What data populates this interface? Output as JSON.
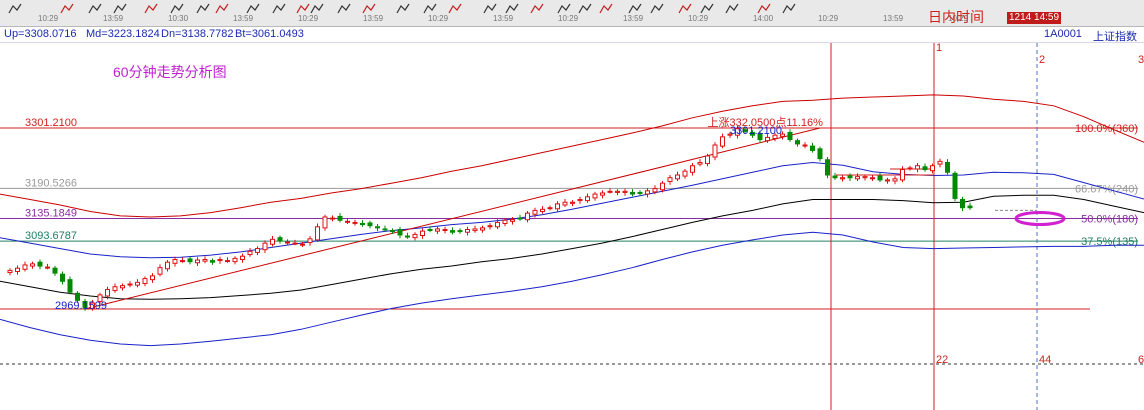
{
  "toolbar": {
    "times": [
      "10:29",
      "13:59",
      "10:30",
      "13:59",
      "10:29",
      "13:59",
      "10:29",
      "13:59",
      "10:29",
      "13:59",
      "10:29",
      "14:00",
      "10:29",
      "13:59",
      "10:29"
    ],
    "right_label": "日内时间",
    "badge": "1214 14:59"
  },
  "status": {
    "up": "Up=3308.0716",
    "md": "Md=3223.1824",
    "dn": "Dn=3138.7782",
    "bt": "Bt=3061.0493",
    "code": "1A0001",
    "name": "上证指数"
  },
  "colors": {
    "candle_up": "#e01010",
    "candle_down": "#008a00",
    "band_outer": "#cc0000",
    "band_inner": "#1822c8",
    "band_mid": "#000000",
    "level_red": "#d02020",
    "level_gray": "#999999",
    "level_purple": "#8a2aa0",
    "level_teal": "#208060",
    "caption": "#c020d0",
    "marker": "#d020d0"
  },
  "chart_data": {
    "type": "candlestick",
    "title": "60分钟走势分析图",
    "ylim": [
      2900,
      3400
    ],
    "levels": [
      {
        "value": 3301.21,
        "label": "3301.2100",
        "right": "100.0%(360)"
      },
      {
        "value": 3190.5266,
        "label": "3190.5266",
        "right": "66.67%(240)"
      },
      {
        "value": 3135.1849,
        "label": "3135.1849",
        "right": "50.0%(180)"
      },
      {
        "value": 3093.6787,
        "label": "3093.6787",
        "right": "37.5%(135)"
      },
      {
        "value": 2969.1599,
        "label": "",
        "right": ""
      }
    ],
    "annotations": [
      {
        "text": "上涨332.0500点11.16%",
        "bar": 97,
        "value": 3305
      },
      {
        "text": "3301.2100",
        "bar": 100,
        "value": 3290
      },
      {
        "text": "2969.1599",
        "bar": 10,
        "value": 2969.16
      }
    ],
    "time_markers": [
      "1",
      "2",
      "22",
      "44",
      "6",
      "3"
    ],
    "closes": [
      3040,
      3044,
      3050,
      3052,
      3048,
      3046,
      3035,
      3020,
      3000,
      2985,
      2972,
      2980,
      2995,
      3005,
      3010,
      3012,
      3015,
      3018,
      3025,
      3030,
      3045,
      3055,
      3060,
      3058,
      3056,
      3059,
      3060,
      3055,
      3060,
      3058,
      3062,
      3066,
      3075,
      3080,
      3090,
      3097,
      3094,
      3092,
      3090,
      3088,
      3098,
      3120,
      3138,
      3136,
      3132,
      3130,
      3128,
      3124,
      3122,
      3118,
      3115,
      3112,
      3105,
      3102,
      3106,
      3112,
      3114,
      3116,
      3115,
      3110,
      3112,
      3115,
      3116,
      3118,
      3122,
      3128,
      3132,
      3133,
      3135,
      3145,
      3150,
      3152,
      3155,
      3162,
      3165,
      3165,
      3170,
      3175,
      3180,
      3182,
      3185,
      3185,
      3185,
      3180,
      3182,
      3186,
      3190,
      3200,
      3210,
      3215,
      3222,
      3232,
      3238,
      3250,
      3270,
      3285,
      3290,
      3300,
      3295,
      3288,
      3280,
      3284,
      3288,
      3290,
      3280,
      3272,
      3270,
      3260,
      3245,
      3215,
      3210,
      3210,
      3210,
      3212,
      3212,
      3210,
      3206,
      3206,
      3208,
      3225,
      3228,
      3232,
      3225,
      3232,
      3240,
      3220,
      3172,
      3155,
      3155
    ],
    "series": [
      {
        "name": "Up",
        "values": [
          3180,
          3170,
          3160,
          3148,
          3140,
          3138,
          3140,
          3146,
          3155,
          3165,
          3172,
          3182,
          3190,
          3200,
          3210,
          3222,
          3232,
          3244,
          3256,
          3268,
          3280,
          3292,
          3305,
          3320,
          3332,
          3342,
          3350,
          3352,
          3356,
          3358,
          3360,
          3362,
          3360,
          3354,
          3350,
          3342,
          3322,
          3298,
          3275
        ]
      },
      {
        "name": "Md",
        "values": [
          3100,
          3090,
          3080,
          3070,
          3065,
          3063,
          3064,
          3068,
          3074,
          3082,
          3090,
          3098,
          3106,
          3113,
          3118,
          3124,
          3128,
          3134,
          3142,
          3152,
          3163,
          3174,
          3185,
          3196,
          3208,
          3220,
          3232,
          3238,
          3233,
          3221,
          3216,
          3214,
          3215,
          3220,
          3219,
          3216,
          3201,
          3186,
          3171
        ]
      },
      {
        "name": "Dn",
        "values": [
          3020,
          3010,
          3000,
          2993,
          2988,
          2987,
          2988,
          2990,
          2994,
          2998,
          3004,
          3014,
          3024,
          3034,
          3042,
          3048,
          3056,
          3062,
          3070,
          3080,
          3090,
          3102,
          3115,
          3128,
          3140,
          3150,
          3162,
          3170,
          3170,
          3170,
          3168,
          3164,
          3165,
          3176,
          3178,
          3178,
          3170,
          3158,
          3146
        ]
      },
      {
        "name": "Bt",
        "values": [
          2950,
          2935,
          2922,
          2912,
          2905,
          2902,
          2905,
          2910,
          2916,
          2922,
          2932,
          2945,
          2958,
          2970,
          2980,
          2988,
          2995,
          3002,
          3010,
          3020,
          3032,
          3045,
          3060,
          3074,
          3086,
          3096,
          3105,
          3110,
          3105,
          3092,
          3082,
          3080,
          3081,
          3082,
          3083,
          3084,
          3084,
          3086,
          3086
        ]
      }
    ],
    "grid": false
  }
}
